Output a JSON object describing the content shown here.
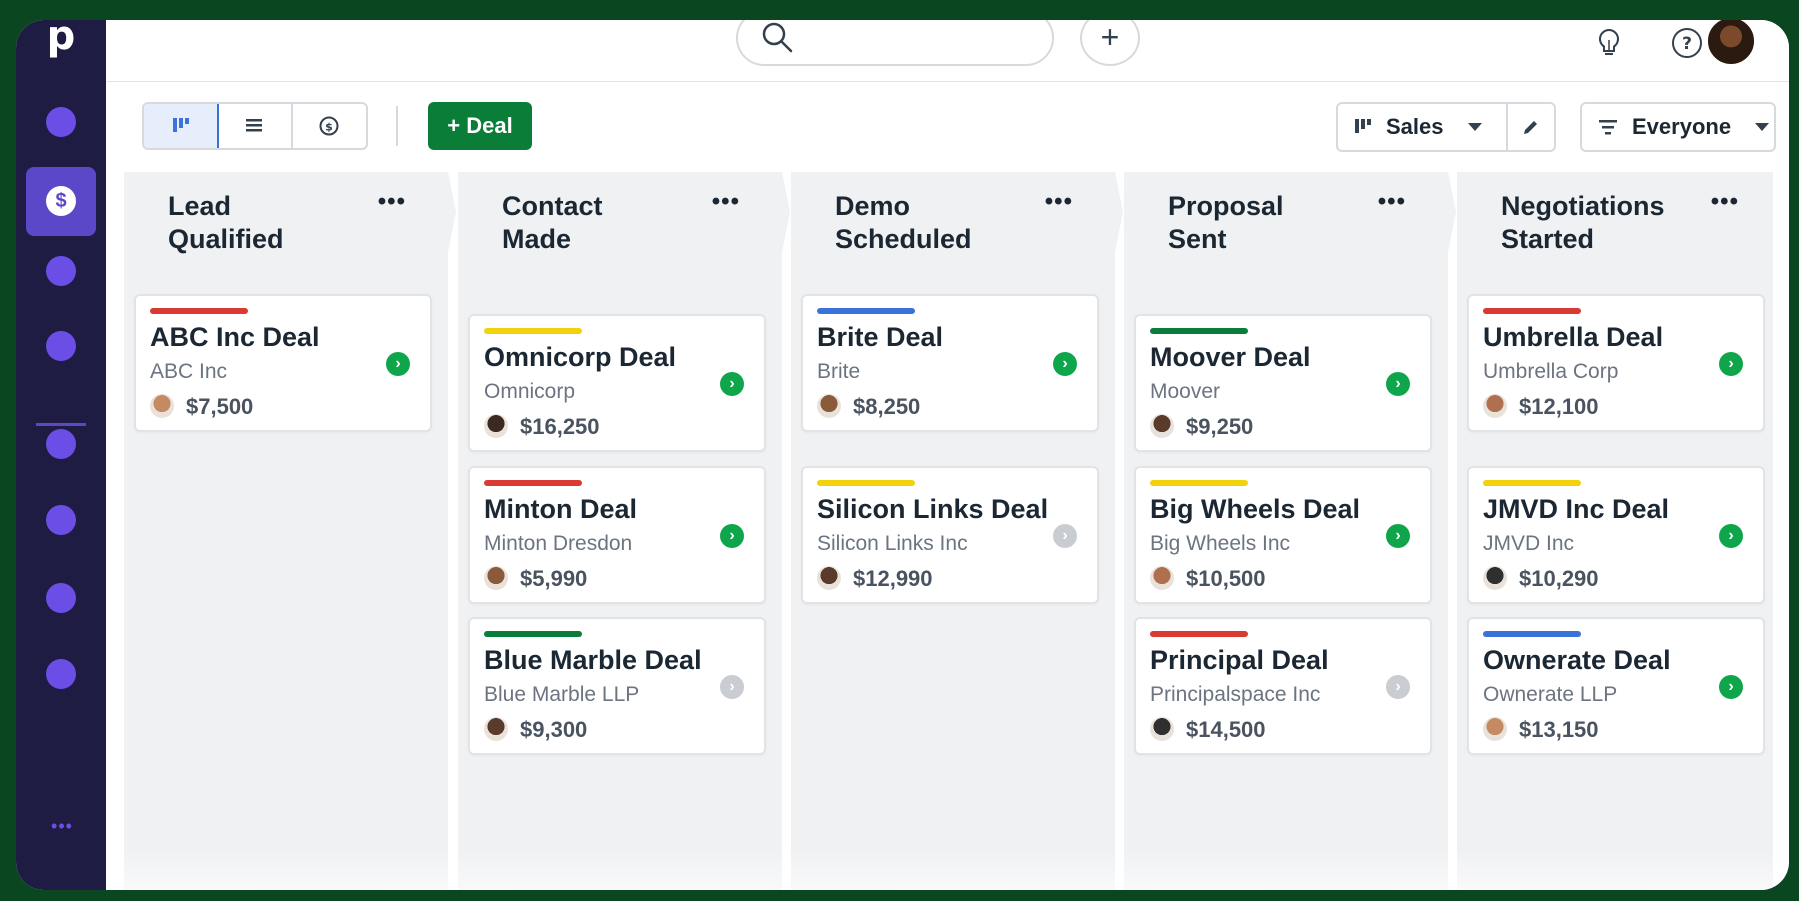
{
  "app": {
    "logo": "p",
    "more_label": "•••"
  },
  "toolbar": {
    "add_deal_label": "+ Deal",
    "pipeline_label": "Sales",
    "filter_label": "Everyone"
  },
  "colors": {
    "accent_green": "#0a7d39",
    "sidebar_bg": "#1f1c44",
    "sidebar_dot": "#6b4ee6"
  },
  "columns": [
    {
      "title_line1": "Lead",
      "title_line2": "Qualified",
      "menu": "•••",
      "cards": [
        {
          "title": "ABC Inc Deal",
          "org": "ABC Inc",
          "amount": "$7,500",
          "bar_color": "#d93a34",
          "status": "green"
        }
      ]
    },
    {
      "title_line1": "Contact",
      "title_line2": "Made",
      "menu": "•••",
      "cards": [
        {
          "title": "Omnicorp Deal",
          "org": "Omnicorp",
          "amount": "$16,250",
          "bar_color": "#f2d20c",
          "status": "green"
        },
        {
          "title": "Minton Deal",
          "org": "Minton Dresdon",
          "amount": "$5,990",
          "bar_color": "#d93a34",
          "status": "green"
        },
        {
          "title": "Blue Marble Deal",
          "org": "Blue Marble LLP",
          "amount": "$9,300",
          "bar_color": "#0a7d39",
          "status": "grey"
        }
      ]
    },
    {
      "title_line1": "Demo",
      "title_line2": "Scheduled",
      "menu": "•••",
      "cards": [
        {
          "title": "Brite Deal",
          "org": "Brite",
          "amount": "$8,250",
          "bar_color": "#3b72d9",
          "status": "green"
        },
        {
          "title": "Silicon Links Deal",
          "org": "Silicon Links Inc",
          "amount": "$12,990",
          "bar_color": "#f2d20c",
          "status": "grey"
        }
      ]
    },
    {
      "title_line1": "Proposal",
      "title_line2": "Sent",
      "menu": "•••",
      "cards": [
        {
          "title": "Moover Deal",
          "org": "Moover",
          "amount": "$9,250",
          "bar_color": "#0a7d39",
          "status": "green"
        },
        {
          "title": "Big Wheels Deal",
          "org": "Big Wheels Inc",
          "amount": "$10,500",
          "bar_color": "#f2d20c",
          "status": "green"
        },
        {
          "title": "Principal Deal",
          "org": "Principalspace Inc",
          "amount": "$14,500",
          "bar_color": "#d93a34",
          "status": "grey"
        }
      ]
    },
    {
      "title_line1": "Negotiations",
      "title_line2": "Started",
      "menu": "•••",
      "cards": [
        {
          "title": "Umbrella Deal",
          "org": "Umbrella Corp",
          "amount": "$12,100",
          "bar_color": "#d93a34",
          "status": "green"
        },
        {
          "title": "JMVD Inc Deal",
          "org": "JMVD Inc",
          "amount": "$10,290",
          "bar_color": "#f2d20c",
          "status": "green"
        },
        {
          "title": "Ownerate Deal",
          "org": "Ownerate LLP",
          "amount": "$13,150",
          "bar_color": "#3b72d9",
          "status": "green"
        }
      ]
    }
  ]
}
